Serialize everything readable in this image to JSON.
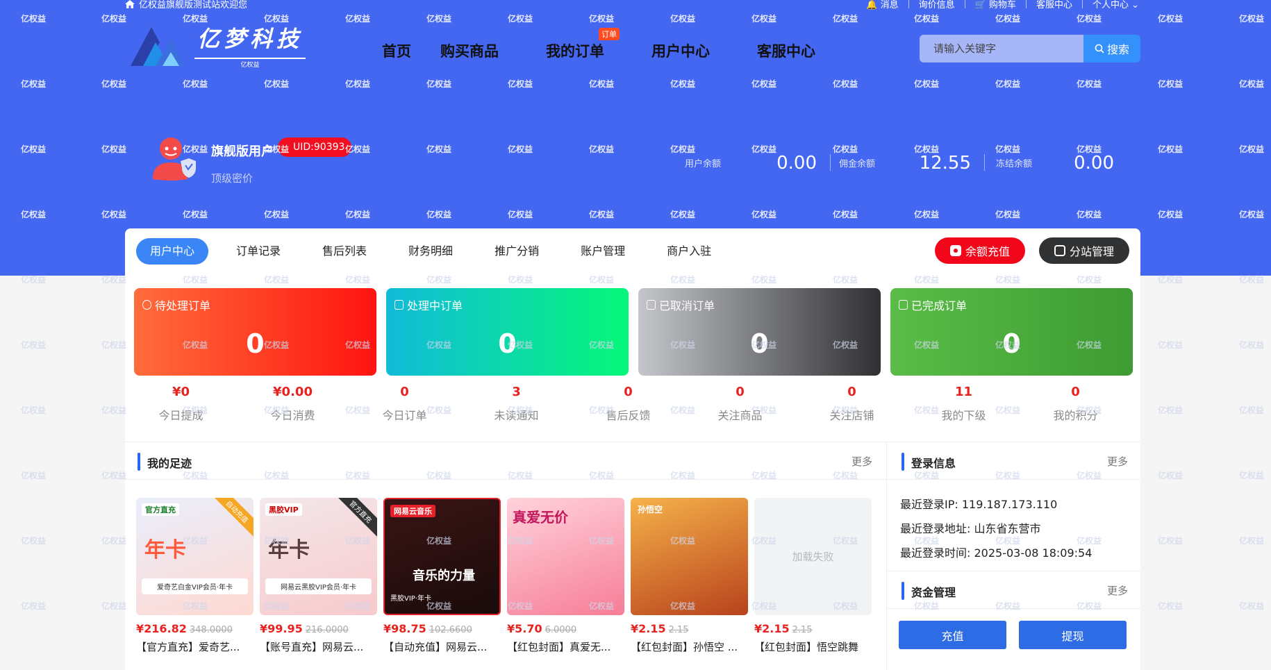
{
  "watermark_text": "亿权益",
  "topbar": {
    "welcome": "亿权益旗舰版测试站欢迎您",
    "links": [
      "消息",
      "询价信息",
      "购物车",
      "客服中心",
      "个人中心"
    ]
  },
  "brand": {
    "name": "亿梦科技",
    "sub": "亿权益"
  },
  "nav": {
    "items": [
      "首页",
      "购买商品",
      "我的订单",
      "用户中心",
      "客服中心"
    ],
    "order_badge": "订单"
  },
  "search": {
    "placeholder": "请输入关键字",
    "button": "搜索"
  },
  "profile": {
    "name": "旗舰版用户",
    "uid": "UID:90393",
    "level": "顶级密价"
  },
  "balances": [
    {
      "label": "用户余额",
      "value": "0.00"
    },
    {
      "label": "佣金余额",
      "value": "12.55"
    },
    {
      "label": "冻结余额",
      "value": "0.00"
    }
  ],
  "tabs": [
    "用户中心",
    "订单记录",
    "售后列表",
    "财务明细",
    "推广分销",
    "账户管理",
    "商户入驻"
  ],
  "actions": {
    "recharge": "余额充值",
    "substation": "分站管理"
  },
  "order_cards": [
    {
      "label": "待处理订单",
      "count": "0"
    },
    {
      "label": "处理中订单",
      "count": "0"
    },
    {
      "label": "已取消订单",
      "count": "0"
    },
    {
      "label": "已完成订单",
      "count": "0"
    }
  ],
  "metrics": [
    {
      "value": "¥0",
      "label": "今日提成"
    },
    {
      "value": "¥0.00",
      "label": "今日消费"
    },
    {
      "value": "0",
      "label": "今日订单"
    },
    {
      "value": "3",
      "label": "未读通知"
    },
    {
      "value": "0",
      "label": "售后反馈"
    },
    {
      "value": "0",
      "label": "关注商品"
    },
    {
      "value": "0",
      "label": "关注店铺"
    },
    {
      "value": "11",
      "label": "我的下级"
    },
    {
      "value": "0",
      "label": "我的积分"
    }
  ],
  "footprint": {
    "title": "我的足迹",
    "more": "更多",
    "items": [
      {
        "tag": "官方直充",
        "big": "年卡",
        "sub": "爱奇艺白金VIP会员·年卡",
        "ribbon": "自动充值",
        "price": "¥216.82",
        "old": "348.0000",
        "title": "【官方直充】爱奇艺..."
      },
      {
        "tag": "黑胶VIP",
        "big": "年卡",
        "sub": "网易云黑胶VIP会员·年卡",
        "ribbon": "官方直充",
        "price": "¥99.95",
        "old": "216.0000",
        "title": "【账号直充】网易云..."
      },
      {
        "tag": "网易云音乐",
        "big": "音乐的力量",
        "sub": "黑胶VIP·年卡",
        "ribbon": "",
        "price": "¥98.75",
        "old": "102.6600",
        "title": "【自动充值】网易云..."
      },
      {
        "tag": "",
        "big": "真爱无价",
        "sub": "",
        "ribbon": "",
        "price": "¥5.70",
        "old": "6.0000",
        "title": "【红包封面】真爱无..."
      },
      {
        "tag": "",
        "big": "孙悟空",
        "sub": "",
        "ribbon": "",
        "price": "¥2.15",
        "old": "2.15",
        "title": "【红包封面】孙悟空 ..."
      },
      {
        "tag": "",
        "big": "",
        "sub": "",
        "ribbon": "",
        "fail": "加载失败",
        "price": "¥2.15",
        "old": "2.15",
        "title": "【红包封面】悟空跳舞"
      }
    ]
  },
  "login_info": {
    "title": "登录信息",
    "more": "更多",
    "ip": "最近登录IP: 119.187.173.110",
    "address": "最近登录地址: 山东省东营市",
    "time": "最近登录时间: 2025-03-08 18:09:54"
  },
  "funds": {
    "title": "资金管理",
    "more": "更多",
    "recharge": "充值",
    "withdraw": "提现"
  },
  "colors": {
    "hero": "#4467f2",
    "accent": "#2e6ce6",
    "price": "#e8231f"
  }
}
